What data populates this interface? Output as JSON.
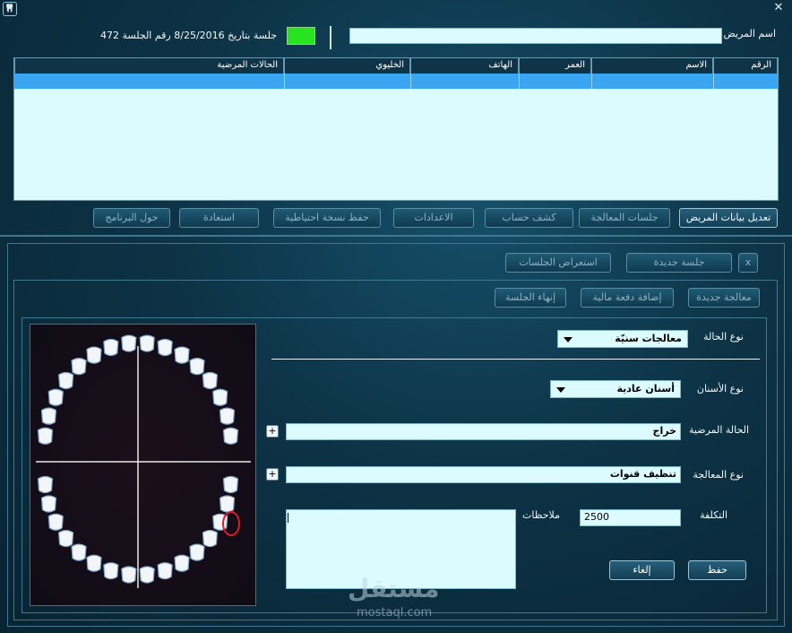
{
  "window": {
    "icon": "tooth-app-icon",
    "close_glyph": "✕"
  },
  "header": {
    "patient_name_label": "اسم المريض",
    "patient_name_value": "",
    "session_info": "جلسة بتاريخ  8/25/2016  رقم الجلسة 472",
    "status_color": "#27e320"
  },
  "grid": {
    "columns": [
      "الرقم",
      "الاسم",
      "العمر",
      "الهاتف",
      "الخليوي",
      "الحالات المرضية"
    ]
  },
  "toolbar": {
    "buttons": [
      "تعديل بيانات المريض",
      "جلسات المعالجة",
      "كشف حساب",
      "الاعدادات",
      "حفظ نسخة احتياطية",
      "استعادة",
      "حول البرنامج"
    ]
  },
  "session_bar": {
    "close_label": "x",
    "new_session": "جلسة جديدة",
    "review_sessions": "استعراض الجلسات"
  },
  "treatment_bar": {
    "new_treatment": "معالجة جديدة",
    "add_payment": "إضافة دفعة مالية",
    "end_session": "إنهاء الجلسة"
  },
  "form": {
    "case_type_label": "نوع الحالة",
    "case_type_value": "معالجات سنيّة",
    "teeth_type_label": "نوع الأسنان",
    "teeth_type_value": "أسنان عادية",
    "condition_label": "الحالة المرضية",
    "condition_value": "خراج",
    "treatment_type_label": "نوع المعالجة",
    "treatment_type_value": "تنظيف  قنوات",
    "cost_label": "التكلفة",
    "cost_value": "2500",
    "notes_label": "ملاحظات",
    "notes_value": "",
    "plus_glyph": "+",
    "save_label": "حفظ",
    "cancel_label": "إلغاء"
  },
  "watermark": {
    "arabic": "مستقل",
    "latin": "mostaql.com"
  },
  "colors": {
    "grid_bg": "#dcfbff",
    "selected_row": "#3aa5f0",
    "selected_tooth_ring": "#e0182a"
  }
}
